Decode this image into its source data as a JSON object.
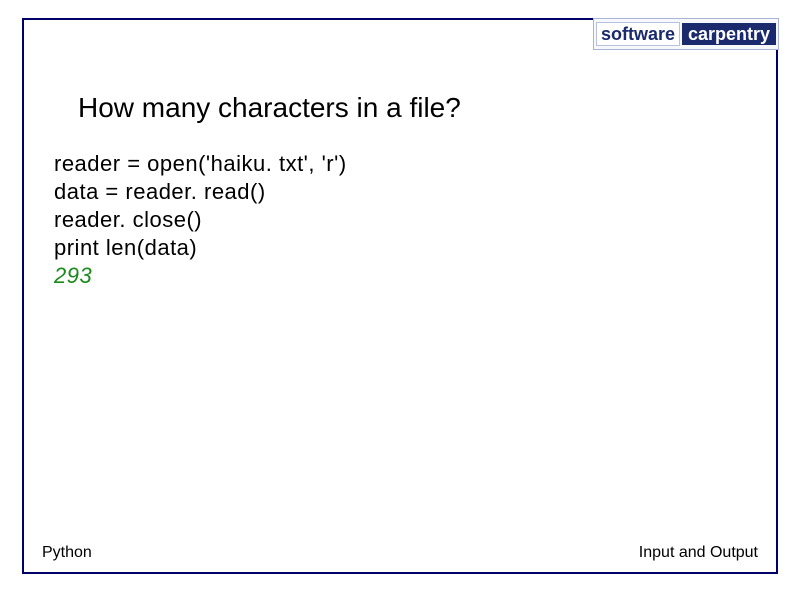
{
  "logo": {
    "left": "software",
    "right": "carpentry"
  },
  "title": "How many characters in a file?",
  "code": {
    "line1": "reader = open('haiku. txt', 'r')",
    "line2": "data = reader. read()",
    "line3": "reader. close()",
    "line4": "print len(data)",
    "output": "293"
  },
  "footer": {
    "left": "Python",
    "right": "Input and Output"
  }
}
